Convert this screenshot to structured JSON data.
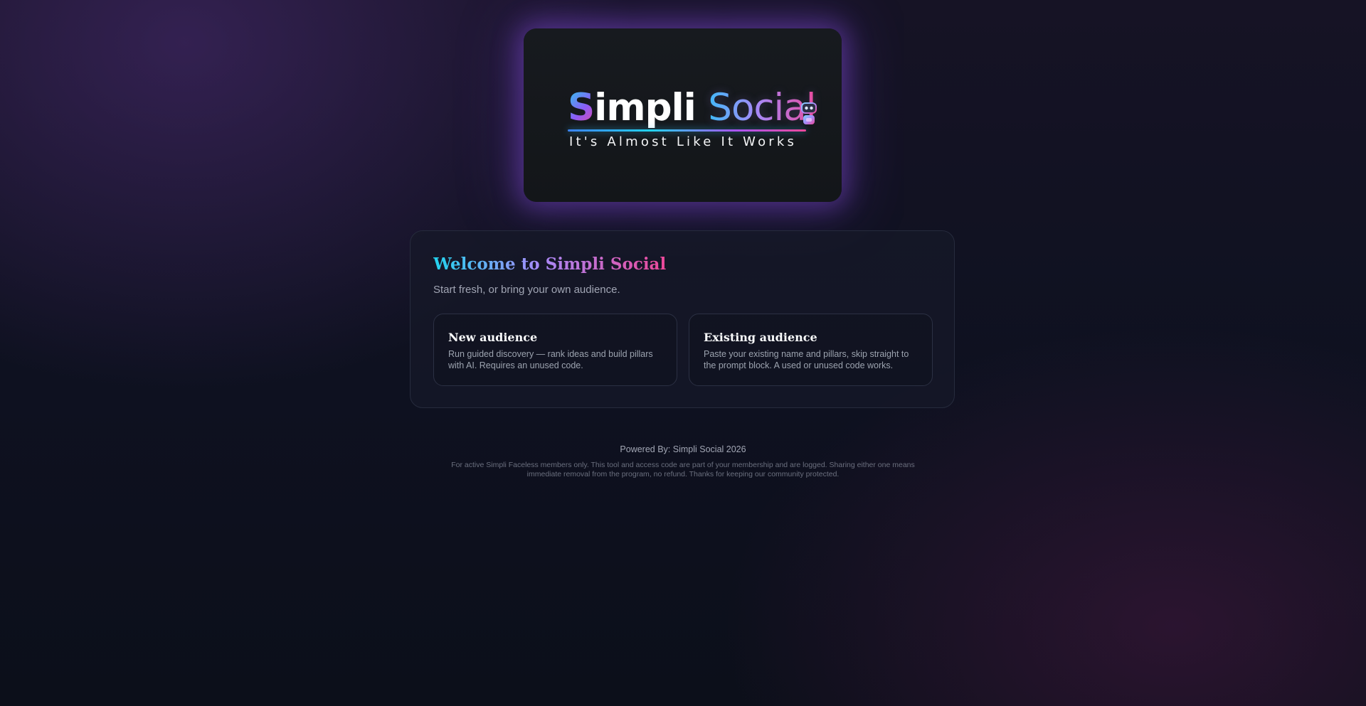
{
  "logo": {
    "title_first_letter": "S",
    "title_rest": "impli",
    "title_second_word": "Social",
    "tagline": "It's Almost Like It Works",
    "icon": "robot-icon"
  },
  "welcome": {
    "title": "Welcome to Simpli Social",
    "subtitle": "Start fresh, or bring your own audience."
  },
  "options": [
    {
      "title": "New audience",
      "description": "Run guided discovery — rank ideas and build pillars with AI. Requires an unused code."
    },
    {
      "title": "Existing audience",
      "description": "Paste your existing name and pillars, skip straight to the prompt block. A used or unused code works."
    }
  ],
  "footer": {
    "powered_by": "Powered By: Simpli Social 2026",
    "notice": "For active Simpli Faceless members only. This tool and access code are part of your membership and are logged. Sharing either one means immediate removal from the program, no refund. Thanks for keeping our community protected."
  },
  "colors": {
    "background": "#0d1019",
    "accent_cyan": "#22d3ee",
    "accent_purple": "#a78bfa",
    "accent_pink": "#ec4899",
    "glow": "#8c50e6"
  }
}
